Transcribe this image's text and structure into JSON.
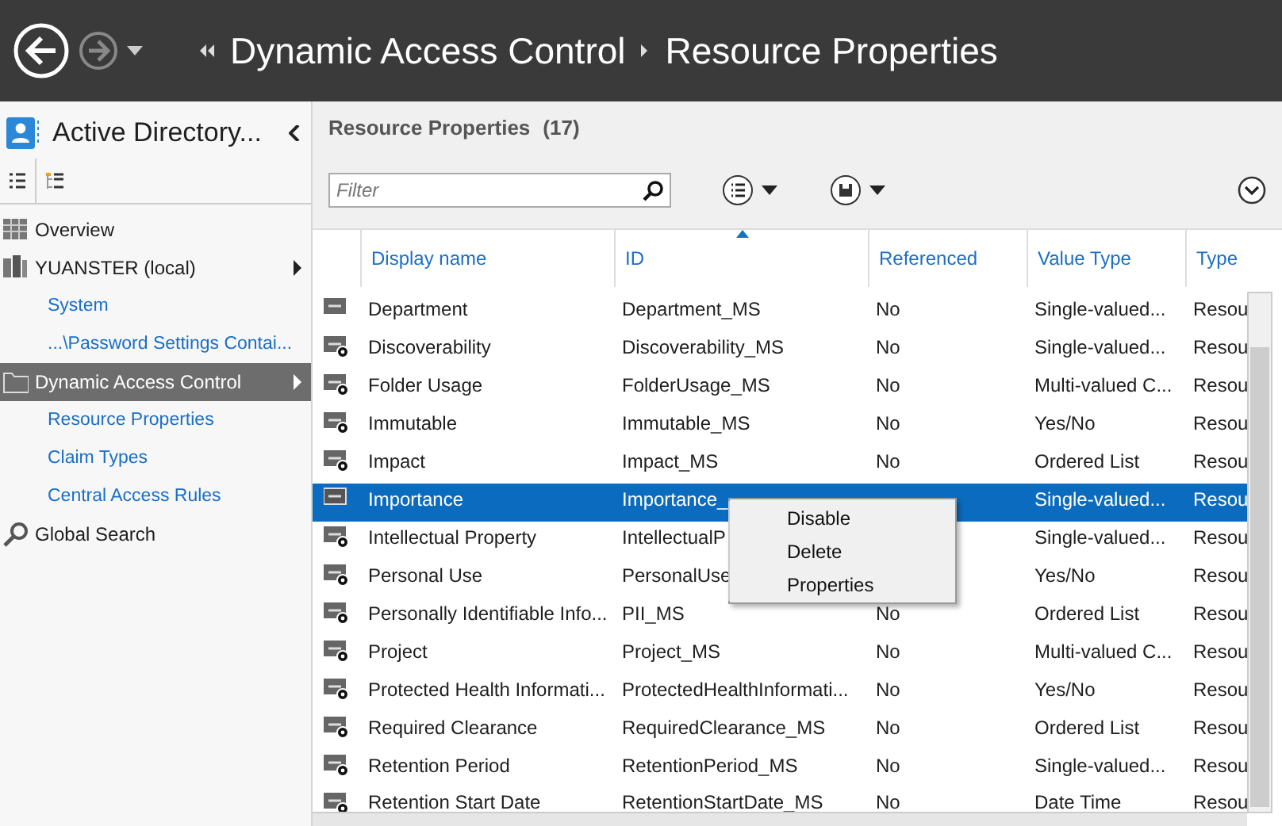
{
  "header": {
    "breadcrumb": [
      {
        "label": "Dynamic Access Control"
      },
      {
        "label": "Resource Properties"
      }
    ]
  },
  "sidebar": {
    "title": "Active Directory...",
    "tabs": [
      {
        "kind": "list",
        "selected": true
      },
      {
        "kind": "tree",
        "selected": false
      }
    ],
    "items": [
      {
        "label": "Overview",
        "kind": "grid",
        "selected": false
      },
      {
        "label": "YUANSTER (local)",
        "kind": "domain",
        "selected": false,
        "expandable": true,
        "children": [
          {
            "label": "System",
            "selected": false
          },
          {
            "label": "...\\Password Settings Contai...",
            "selected": false
          }
        ]
      },
      {
        "label": "Dynamic Access Control",
        "kind": "folder",
        "selected": true,
        "expandable": true,
        "children": [
          {
            "label": "Resource Properties",
            "selected": false
          },
          {
            "label": "Claim Types",
            "selected": false
          },
          {
            "label": "Central Access Rules",
            "selected": false
          }
        ]
      },
      {
        "label": "Global Search",
        "kind": "search",
        "selected": false,
        "expandable": false
      }
    ]
  },
  "panel": {
    "title": "Resource Properties",
    "count": "(17)",
    "filter": {
      "placeholder": "Filter"
    }
  },
  "table": {
    "columns": [
      {
        "label": "Display name",
        "sorted": false
      },
      {
        "label": "ID",
        "sorted": true
      },
      {
        "label": "Referenced",
        "sorted": false
      },
      {
        "label": "Value Type",
        "sorted": false
      },
      {
        "label": "Type",
        "sorted": false
      }
    ],
    "rows": [
      {
        "cells": [
          "Department",
          "Department_MS",
          "No",
          "Single-valued...",
          "Resou"
        ],
        "disabled": false,
        "selected": false
      },
      {
        "cells": [
          "Discoverability",
          "Discoverability_MS",
          "No",
          "Single-valued...",
          "Resou"
        ],
        "disabled": true,
        "selected": false
      },
      {
        "cells": [
          "Folder Usage",
          "FolderUsage_MS",
          "No",
          "Multi-valued C...",
          "Resou"
        ],
        "disabled": true,
        "selected": false
      },
      {
        "cells": [
          "Immutable",
          "Immutable_MS",
          "No",
          "Yes/No",
          "Resou"
        ],
        "disabled": true,
        "selected": false
      },
      {
        "cells": [
          "Impact",
          "Impact_MS",
          "No",
          "Ordered List",
          "Resou"
        ],
        "disabled": true,
        "selected": false
      },
      {
        "cells": [
          "Importance",
          "Importance_",
          "",
          "Single-valued...",
          "Resou"
        ],
        "disabled": false,
        "selected": true
      },
      {
        "cells": [
          "Intellectual Property",
          "IntellectualP",
          "",
          "Single-valued...",
          "Resou"
        ],
        "disabled": true,
        "selected": false
      },
      {
        "cells": [
          "Personal Use",
          "PersonalUse",
          "",
          "Yes/No",
          "Resou"
        ],
        "disabled": true,
        "selected": false
      },
      {
        "cells": [
          "Personally Identifiable Info...",
          "PII_MS",
          "No",
          "Ordered List",
          "Resou"
        ],
        "disabled": true,
        "selected": false
      },
      {
        "cells": [
          "Project",
          "Project_MS",
          "No",
          "Multi-valued C...",
          "Resou"
        ],
        "disabled": true,
        "selected": false
      },
      {
        "cells": [
          "Protected Health Informati...",
          "ProtectedHealthInformati...",
          "No",
          "Yes/No",
          "Resou"
        ],
        "disabled": true,
        "selected": false
      },
      {
        "cells": [
          "Required Clearance",
          "RequiredClearance_MS",
          "No",
          "Ordered List",
          "Resou"
        ],
        "disabled": true,
        "selected": false
      },
      {
        "cells": [
          "Retention Period",
          "RetentionPeriod_MS",
          "No",
          "Single-valued...",
          "Resou"
        ],
        "disabled": true,
        "selected": false
      },
      {
        "cells": [
          "Retention Start Date",
          "RetentionStartDate_MS",
          "No",
          "Date Time",
          "Resou"
        ],
        "disabled": true,
        "selected": false
      }
    ]
  },
  "context_menu": {
    "items": [
      {
        "label": "Disable"
      },
      {
        "label": "Delete"
      },
      {
        "label": "Properties"
      }
    ]
  }
}
